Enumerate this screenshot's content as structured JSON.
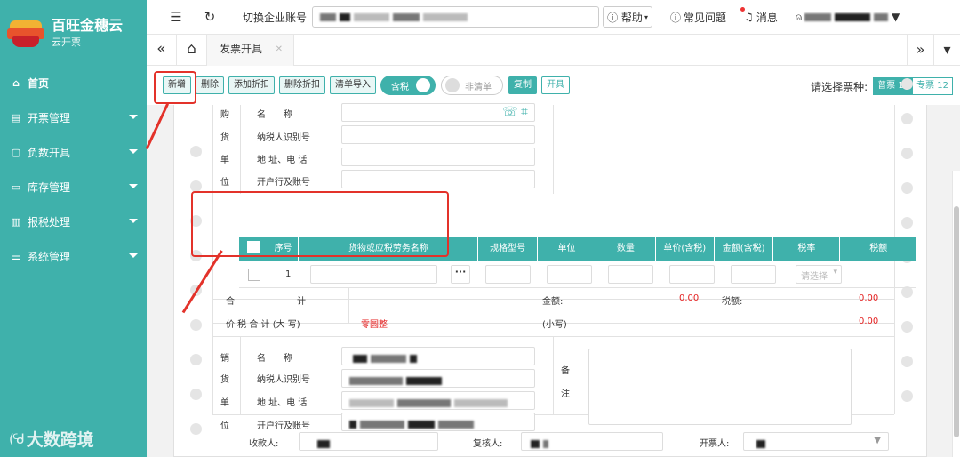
{
  "brand": {
    "name": "百旺金穗云",
    "sub": "云开票"
  },
  "sidebar": {
    "items": [
      {
        "label": "首页",
        "icon": "home-icon"
      },
      {
        "label": "开票管理",
        "icon": "invoice-icon"
      },
      {
        "label": "负数开具",
        "icon": "document-icon"
      },
      {
        "label": "库存管理",
        "icon": "inventory-icon"
      },
      {
        "label": "报税处理",
        "icon": "chart-icon"
      },
      {
        "label": "系统管理",
        "icon": "settings-icon"
      }
    ]
  },
  "watermark": "大数跨境",
  "topbar": {
    "switch_label": "切换企业账号",
    "help": "帮助",
    "faq": "常见问题",
    "messages": "消息"
  },
  "tabs": {
    "active": "发票开具"
  },
  "toolbar": {
    "buttons": [
      "新增",
      "删除",
      "添加折扣",
      "删除折扣",
      "清单导入"
    ],
    "tax_toggle": "含税",
    "list_toggle": "非清单",
    "copy": "复制",
    "issue": "开具",
    "ticket_label": "请选择票种:",
    "ticket_types": [
      "普票 15",
      "专票 12"
    ]
  },
  "buyer": {
    "side": [
      "购",
      "货",
      "单",
      "位"
    ],
    "labels": [
      "名　　称",
      "纳税人识别号",
      "地 址、电 话",
      "开户行及账号"
    ]
  },
  "table": {
    "headers": [
      "序号",
      "货物或应税劳务名称",
      "规格型号",
      "单位",
      "数量",
      "单价(含税)",
      "金额(含税)",
      "税率",
      "税额"
    ],
    "row_no": "1",
    "rate_placeholder": "请选择"
  },
  "totals": {
    "sum_label": "合　　　　　　　计",
    "amount_label": "金额:",
    "amount": "0.00",
    "tax_label": "税额:",
    "tax": "0.00",
    "grand_label": "价 税 合 计 (大 写)",
    "grand_upper": "零圆整",
    "small_label": "(小写)",
    "small": "0.00"
  },
  "seller": {
    "side": [
      "销",
      "货",
      "单",
      "位"
    ],
    "labels": [
      "名　　称",
      "纳税人识别号",
      "地 址、电 话",
      "开户行及账号"
    ],
    "remark": [
      "备",
      "注"
    ]
  },
  "footer": {
    "payee": "收款人:",
    "reviewer": "复核人:",
    "drawer": "开票人:"
  }
}
